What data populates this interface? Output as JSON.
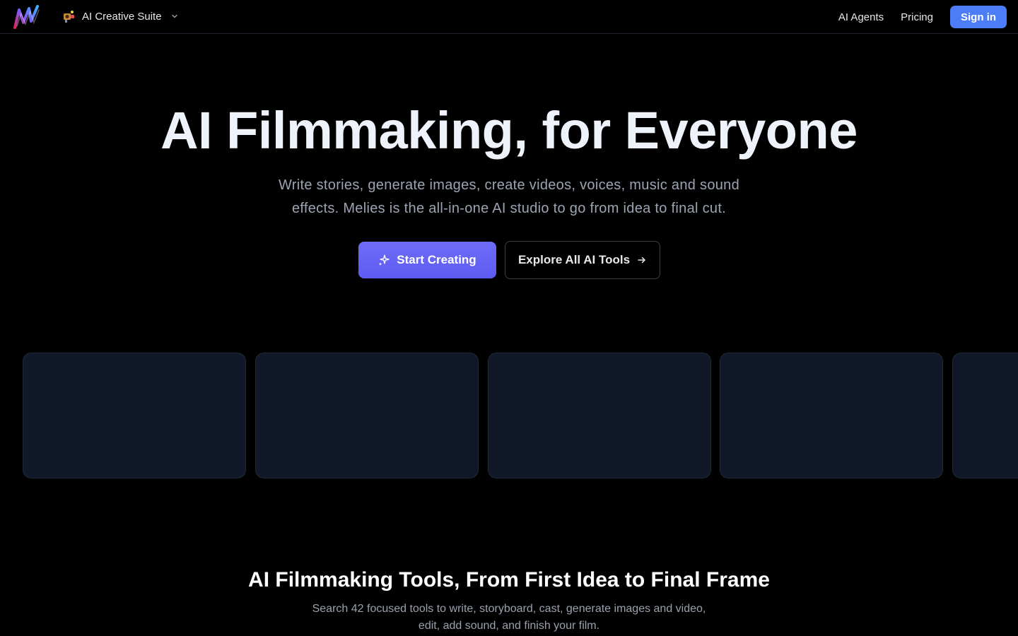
{
  "nav": {
    "suite_label": "AI Creative Suite",
    "agents_label": "AI Agents",
    "pricing_label": "Pricing",
    "signin_label": "Sign in"
  },
  "hero": {
    "title": "AI Filmmaking, for Everyone",
    "subtitle": "Write stories, generate images, create videos, voices, music and sound effects. Melies is the all-in-one AI studio to go from idea to final cut.",
    "primary_cta": "Start Creating",
    "secondary_cta": "Explore All AI Tools"
  },
  "section": {
    "title": "AI Filmmaking Tools, From First Idea to Final Frame",
    "subtitle": "Search 42 focused tools to write, storyboard, cast, generate images and video, edit, add sound, and finish your film."
  },
  "icons": {
    "logo": "melies-logo",
    "suite": "creative-suite-icon",
    "chevron": "chevron-down-icon",
    "sparkle": "sparkle-icon",
    "arrow": "arrow-right-icon"
  },
  "colors": {
    "background": "#000000",
    "accent_blue": "#4d7cf8",
    "accent_purple": "#6366f1",
    "card": "#111827"
  }
}
